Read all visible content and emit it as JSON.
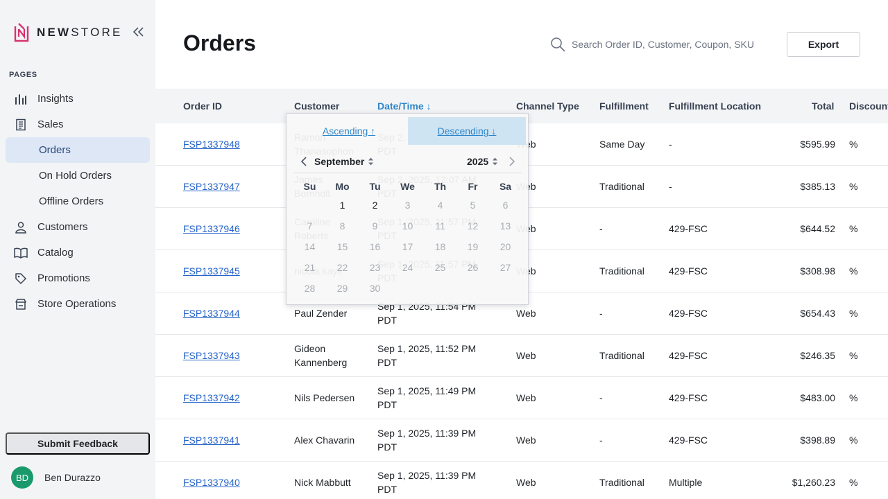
{
  "brand": {
    "name_bold": "NEW",
    "name_rest": "STORE"
  },
  "sidebar": {
    "section_label": "PAGES",
    "items": [
      {
        "label": "Insights",
        "icon": "bar-chart-icon",
        "active": false
      },
      {
        "label": "Sales",
        "icon": "receipt-icon",
        "active": false
      },
      {
        "label": "Orders",
        "icon": "",
        "active": true
      },
      {
        "label": "On Hold Orders",
        "icon": "",
        "active": false
      },
      {
        "label": "Offline Orders",
        "icon": "",
        "active": false
      },
      {
        "label": "Customers",
        "icon": "person-icon",
        "active": false
      },
      {
        "label": "Catalog",
        "icon": "book-icon",
        "active": false
      },
      {
        "label": "Promotions",
        "icon": "tag-icon",
        "active": false
      },
      {
        "label": "Store Operations",
        "icon": "store-icon",
        "active": false
      }
    ],
    "feedback_label": "Submit Feedback",
    "user": {
      "initials": "BD",
      "name": "Ben Durazzo"
    }
  },
  "header": {
    "title": "Orders",
    "search_placeholder": "Search Order ID, Customer, Coupon, SKU",
    "export_label": "Export"
  },
  "table": {
    "columns": [
      "Order ID",
      "Customer",
      "Date/Time ↓",
      "Channel Type",
      "Fulfillment",
      "Fulfillment Location",
      "Total",
      "Discount"
    ],
    "sorted_column": "Date/Time",
    "rows": [
      {
        "id": "FSP1337948",
        "customer": [
          "Ramon",
          "Thanasophon"
        ],
        "date": [
          "Sep 2, 2025, 12:10 AM",
          "PDT"
        ],
        "channel": "Web",
        "fulfillment": "Same Day",
        "location": "-",
        "total": "$595.99",
        "discount": "%"
      },
      {
        "id": "FSP1337947",
        "customer": [
          "James",
          "Bornholt"
        ],
        "date": [
          "Sep 2, 2025, 12:07 AM",
          "PDT"
        ],
        "channel": "Web",
        "fulfillment": "Traditional",
        "location": "-",
        "total": "$385.13",
        "discount": "%"
      },
      {
        "id": "FSP1337946",
        "customer": [
          "Caroline",
          "Roberts"
        ],
        "date": [
          "Sep 1, 2025, 11:57 PM",
          "PDT"
        ],
        "channel": "Web",
        "fulfillment": "-",
        "location": "429-FSC",
        "total": "$644.52",
        "discount": "%"
      },
      {
        "id": "FSP1337945",
        "customer": [
          "nicola kaye",
          ""
        ],
        "date": [
          "Sep 1, 2025, 11:57 PM",
          "PDT"
        ],
        "channel": "Web",
        "fulfillment": "Traditional",
        "location": "429-FSC",
        "total": "$308.98",
        "discount": "%"
      },
      {
        "id": "FSP1337944",
        "customer": [
          "Paul Zender",
          ""
        ],
        "date": [
          "Sep 1, 2025, 11:54 PM",
          "PDT"
        ],
        "channel": "Web",
        "fulfillment": "-",
        "location": "429-FSC",
        "total": "$654.43",
        "discount": "%"
      },
      {
        "id": "FSP1337943",
        "customer": [
          "Gideon",
          "Kannenberg"
        ],
        "date": [
          "Sep 1, 2025, 11:52 PM",
          "PDT"
        ],
        "channel": "Web",
        "fulfillment": "Traditional",
        "location": "429-FSC",
        "total": "$246.35",
        "discount": "%"
      },
      {
        "id": "FSP1337942",
        "customer": [
          "Nils Pedersen",
          ""
        ],
        "date": [
          "Sep 1, 2025, 11:49 PM",
          "PDT"
        ],
        "channel": "Web",
        "fulfillment": "-",
        "location": "429-FSC",
        "total": "$483.00",
        "discount": "%"
      },
      {
        "id": "FSP1337941",
        "customer": [
          "Alex Chavarin",
          ""
        ],
        "date": [
          "Sep 1, 2025, 11:39 PM",
          "PDT"
        ],
        "channel": "Web",
        "fulfillment": "-",
        "location": "429-FSC",
        "total": "$398.89",
        "discount": "%"
      },
      {
        "id": "FSP1337940",
        "customer": [
          "Nick Mabbutt",
          ""
        ],
        "date": [
          "Sep 1, 2025, 11:39 PM",
          "PDT"
        ],
        "channel": "Web",
        "fulfillment": "Traditional",
        "location": "Multiple",
        "total": "$1,260.23",
        "discount": "%"
      }
    ]
  },
  "sort_popup": {
    "ascending_label": "Ascending ↑",
    "descending_label": "Descending ↓",
    "selected": "descending",
    "month": "September",
    "year": "2025",
    "weekdays": [
      "Su",
      "Mo",
      "Tu",
      "We",
      "Th",
      "Fr",
      "Sa"
    ],
    "first_weekday_index": 1,
    "days_in_month": 30,
    "enabled_days": [
      1,
      2
    ]
  },
  "colors": {
    "accent": "#2e86c9",
    "active_nav": "#dde7f6",
    "avatar": "#1a9a6b",
    "brand": "#d6336c"
  }
}
